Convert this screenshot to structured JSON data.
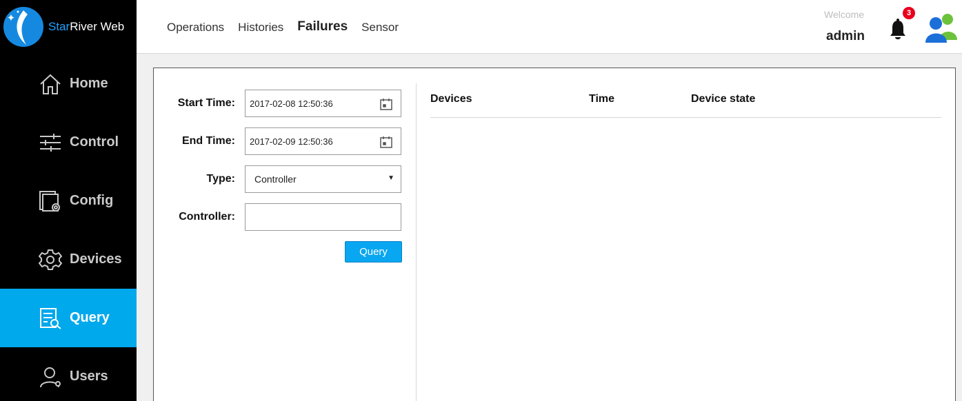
{
  "brand": {
    "name_accent": "Star",
    "name_rest": "River Web"
  },
  "sidebar": {
    "items": [
      {
        "label": "Home",
        "icon": "home-icon",
        "active": false
      },
      {
        "label": "Control",
        "icon": "sliders-icon",
        "active": false
      },
      {
        "label": "Config",
        "icon": "config-icon",
        "active": false
      },
      {
        "label": "Devices",
        "icon": "gear-icon",
        "active": false
      },
      {
        "label": "Query",
        "icon": "query-icon",
        "active": true
      },
      {
        "label": "Users",
        "icon": "user-icon",
        "active": false
      }
    ]
  },
  "header": {
    "tabs": [
      {
        "label": "Operations",
        "active": false
      },
      {
        "label": "Histories",
        "active": false
      },
      {
        "label": "Failures",
        "active": true
      },
      {
        "label": "Sensor",
        "active": false
      }
    ],
    "welcome": "Welcome",
    "username": "admin",
    "notification_count": "3"
  },
  "form": {
    "start_time_label": "Start Time:",
    "start_time_value": "2017-02-08 12:50:36",
    "end_time_label": "End Time:",
    "end_time_value": "2017-02-09 12:50:36",
    "type_label": "Type:",
    "type_value": "Controller",
    "controller_label": "Controller:",
    "controller_value": "",
    "query_button": "Query"
  },
  "results": {
    "columns": [
      "Devices",
      "Time",
      "Device state"
    ],
    "rows": []
  },
  "colors": {
    "active_nav": "#00a8ec",
    "sidebar_bg": "#000000",
    "button": "#09a6f1",
    "badge": "#e8001c",
    "brand_accent": "#1fa2ff"
  }
}
